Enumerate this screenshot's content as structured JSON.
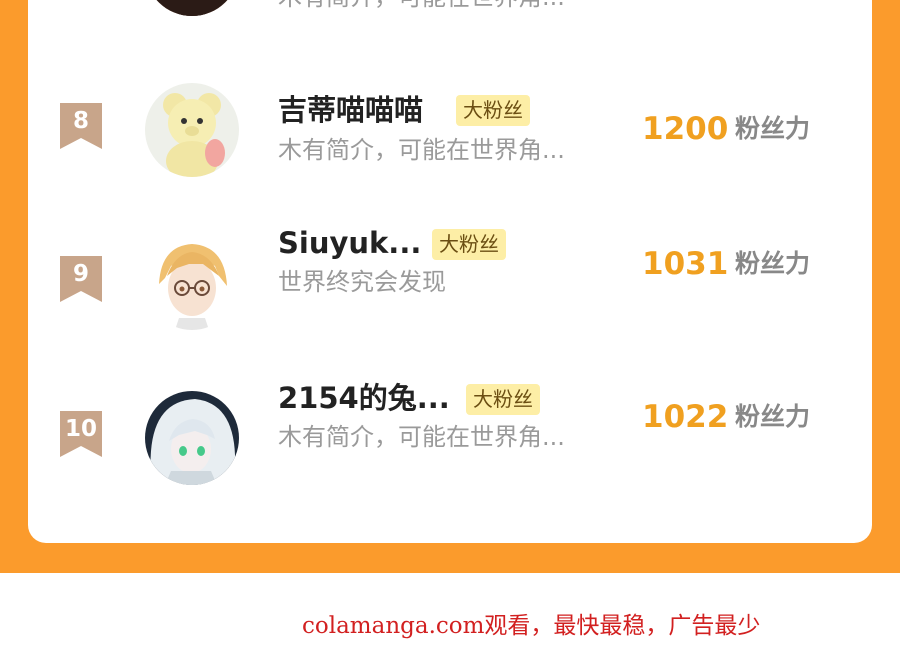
{
  "leaderboard": {
    "rows": [
      {
        "rank": "",
        "name": "",
        "badge": "",
        "bio": "木有简介，可能在世界角...",
        "score": "",
        "score_unit": ""
      },
      {
        "rank": "8",
        "name": "吉蒂喵喵喵",
        "badge": "大粉丝",
        "bio": "木有简介，可能在世界角...",
        "score": "1200",
        "score_unit": "粉丝力"
      },
      {
        "rank": "9",
        "name": "Siuyuk...",
        "badge": "大粉丝",
        "bio": "世界终究会发现",
        "score": "1031",
        "score_unit": "粉丝力"
      },
      {
        "rank": "10",
        "name": "2154的兔...",
        "badge": "大粉丝",
        "bio": "木有简介，可能在世界角...",
        "score": "1022",
        "score_unit": "粉丝力"
      }
    ]
  },
  "watermark": "colamanga.com观看，最快最稳，广告最少",
  "colors": {
    "accent": "#fb9b2c",
    "rank_ribbon": "#c8a58a",
    "badge_bg": "#fdeea6",
    "score": "#f0a020",
    "watermark": "#d22020"
  }
}
